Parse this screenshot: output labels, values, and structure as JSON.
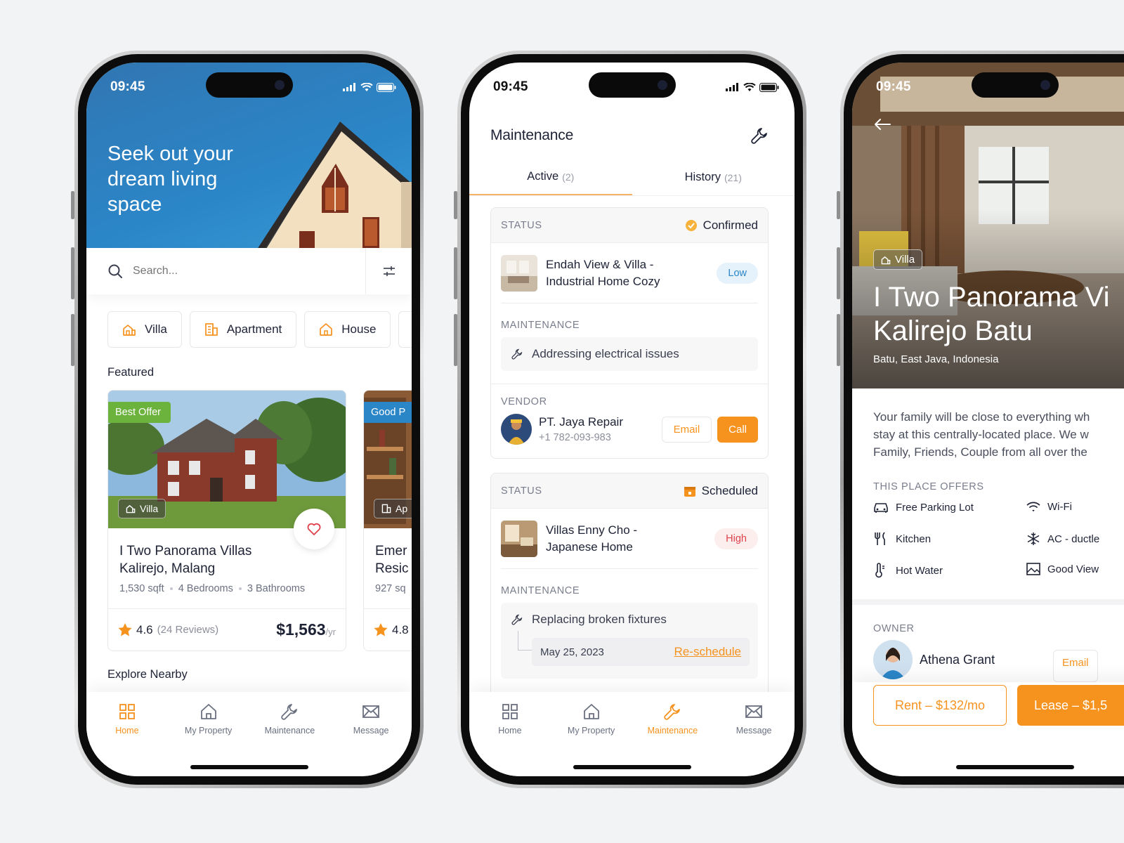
{
  "status_time": "09:45",
  "colors": {
    "accent": "#f6921e",
    "hero_blue": "#2b86c8",
    "offer_green": "#6cb33e",
    "text": "#1e2235"
  },
  "phone1": {
    "hero_title": "Seek out your dream living space",
    "search_placeholder": "Search...",
    "categories": [
      {
        "label": "Villa",
        "icon": "villa-icon"
      },
      {
        "label": "Apartment",
        "icon": "apartment-icon"
      },
      {
        "label": "House",
        "icon": "house-icon"
      }
    ],
    "featured_label": "Featured",
    "card1": {
      "badge": "Best Offer",
      "type_tag": "Villa",
      "title": "I Two Panorama Villas Kalirejo, Malang",
      "area": "1,530 sqft",
      "bedrooms": "4 Bedrooms",
      "bathrooms": "3 Bathrooms",
      "rating": "4.6",
      "reviews": "(24 Reviews)",
      "price": "$1,563",
      "price_unit": "/yr"
    },
    "card2": {
      "badge": "Good P",
      "type_tag": "Ap",
      "title": "Emer Resic",
      "area": "927 sq",
      "rating": "4.8"
    },
    "explore_label": "Explore Nearby"
  },
  "nav": [
    "Home",
    "My Property",
    "Maintenance",
    "Message"
  ],
  "phone2": {
    "title": "Maintenance",
    "tabs": [
      {
        "label": "Active",
        "count": "(2)"
      },
      {
        "label": "History",
        "count": "(21)"
      }
    ],
    "labels": {
      "status": "STATUS",
      "maintenance": "MAINTENANCE",
      "vendor": "VENDOR"
    },
    "item1": {
      "status": "Confirmed",
      "property": "Endah View & Villa - Industrial Home Cozy",
      "priority": "Low",
      "issue": "Addressing electrical issues",
      "vendor_name": "PT. Jaya Repair",
      "vendor_phone": "+1 782-093-983",
      "email_label": "Email",
      "call_label": "Call"
    },
    "item2": {
      "status": "Scheduled",
      "property": "Villas Enny Cho - Japanese Home",
      "priority": "High",
      "issue": "Replacing broken fixtures",
      "date": "May 25, 2023",
      "reschedule_label": "Re-schedule"
    }
  },
  "phone3": {
    "type_tag": "Villa",
    "title_line1": "I Two Panorama Vi",
    "title_line2": "Kalirejo Batu",
    "location": "Batu, East Java, Indonesia",
    "desc_line1": "Your family will be close to everything wh",
    "desc_line2": "stay at this centrally-located place. We w",
    "desc_line3": "Family, Friends, Couple from all over the",
    "offers_label": "THIS PLACE OFFERS",
    "amenities": [
      "Free Parking Lot",
      "Wi-Fi",
      "Kitchen",
      "AC - ductle",
      "Hot Water",
      "Good View"
    ],
    "owner_label": "OWNER",
    "owner_name": "Athena Grant",
    "owner_email": "Email",
    "rent_label": "Rent – $132/mo",
    "lease_label": "Lease – $1,5"
  }
}
